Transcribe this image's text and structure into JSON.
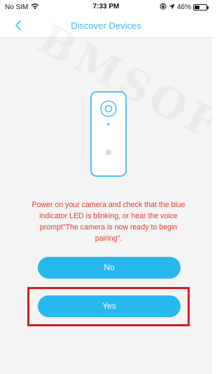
{
  "status_bar": {
    "carrier": "No SIM",
    "time": "7:33 PM",
    "battery_percent": "46%",
    "battery_level": 0.46,
    "icons": [
      "wifi-icon",
      "orientation-lock-icon",
      "location-arrow-icon",
      "battery-icon"
    ]
  },
  "nav": {
    "title": "Discover Devices",
    "back_icon": "chevron-left-icon",
    "accent_color": "#3eb9e9"
  },
  "main": {
    "watermark": "BMSOFT",
    "illustration": "camera-icon",
    "instruction": "Power on your camera and check that the blue indicator LED is blinking, or hear the voice prompt\"The camera is now ready to begin pairing\".",
    "instruction_color": "#e43a2f",
    "buttons": {
      "no_label": "No",
      "yes_label": "Yes",
      "button_color": "#27b9ee"
    },
    "highlight_color": "#d41b24"
  }
}
